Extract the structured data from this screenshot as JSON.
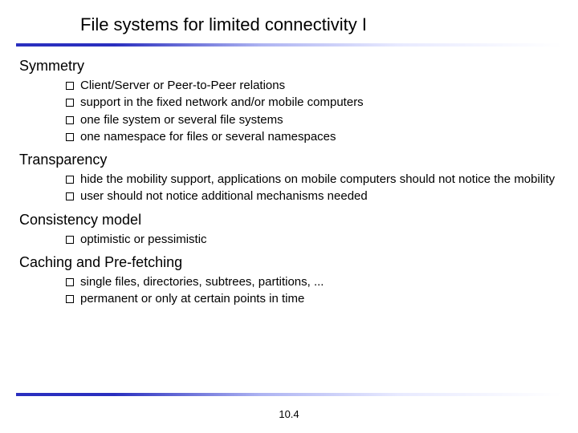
{
  "title": "File systems for limited connectivity I",
  "pagenum": "10.4",
  "sections": [
    {
      "heading": "Symmetry",
      "items": [
        "Client/Server or Peer-to-Peer relations",
        "support in the fixed network and/or mobile computers",
        "one file system or several file systems",
        "one namespace for files or several namespaces"
      ]
    },
    {
      "heading": "Transparency",
      "items": [
        "hide the mobility support, applications on mobile computers should not notice the mobility",
        "user should not notice additional mechanisms needed"
      ]
    },
    {
      "heading": "Consistency model",
      "items": [
        "optimistic or pessimistic"
      ]
    },
    {
      "heading": "Caching and Pre-fetching",
      "items": [
        "single files, directories, subtrees, partitions, ...",
        "permanent or only at certain points in time"
      ]
    }
  ]
}
